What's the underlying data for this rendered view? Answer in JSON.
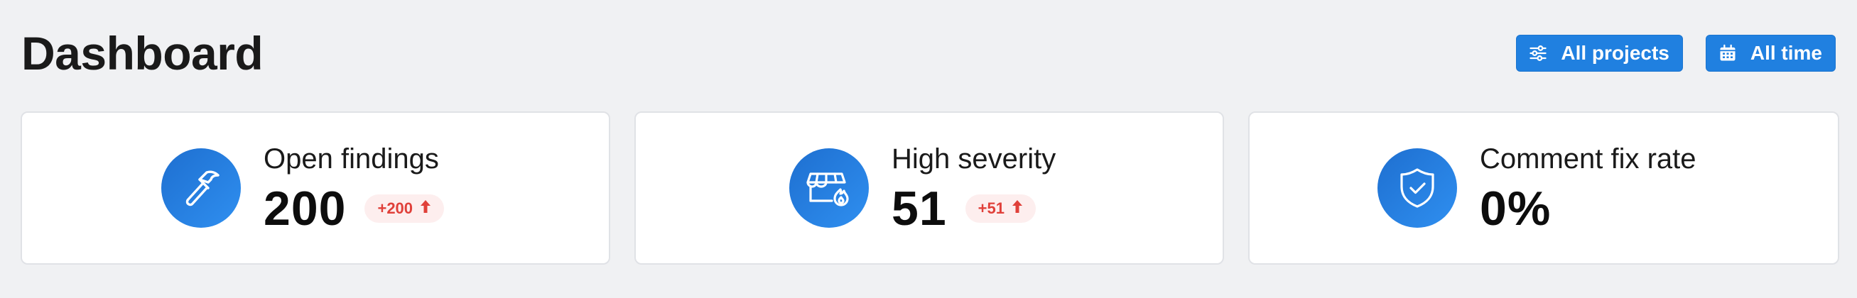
{
  "header": {
    "title": "Dashboard",
    "projects_label": "All projects",
    "projects_icon": "sliders-icon",
    "time_label": "All time",
    "time_icon": "calendar-icon"
  },
  "colors": {
    "accent": "#2080e0",
    "background": "#f0f1f3",
    "delta_text": "#e0403a",
    "delta_bg": "#fdeeee"
  },
  "cards": [
    {
      "label": "Open findings",
      "value": "200",
      "delta": "+200",
      "delta_direction": "up",
      "icon": "hammer-icon"
    },
    {
      "label": "High severity",
      "value": "51",
      "delta": "+51",
      "delta_direction": "up",
      "icon": "storefront-fire-icon"
    },
    {
      "label": "Comment fix rate",
      "value": "0%",
      "icon": "shield-check-icon"
    }
  ]
}
